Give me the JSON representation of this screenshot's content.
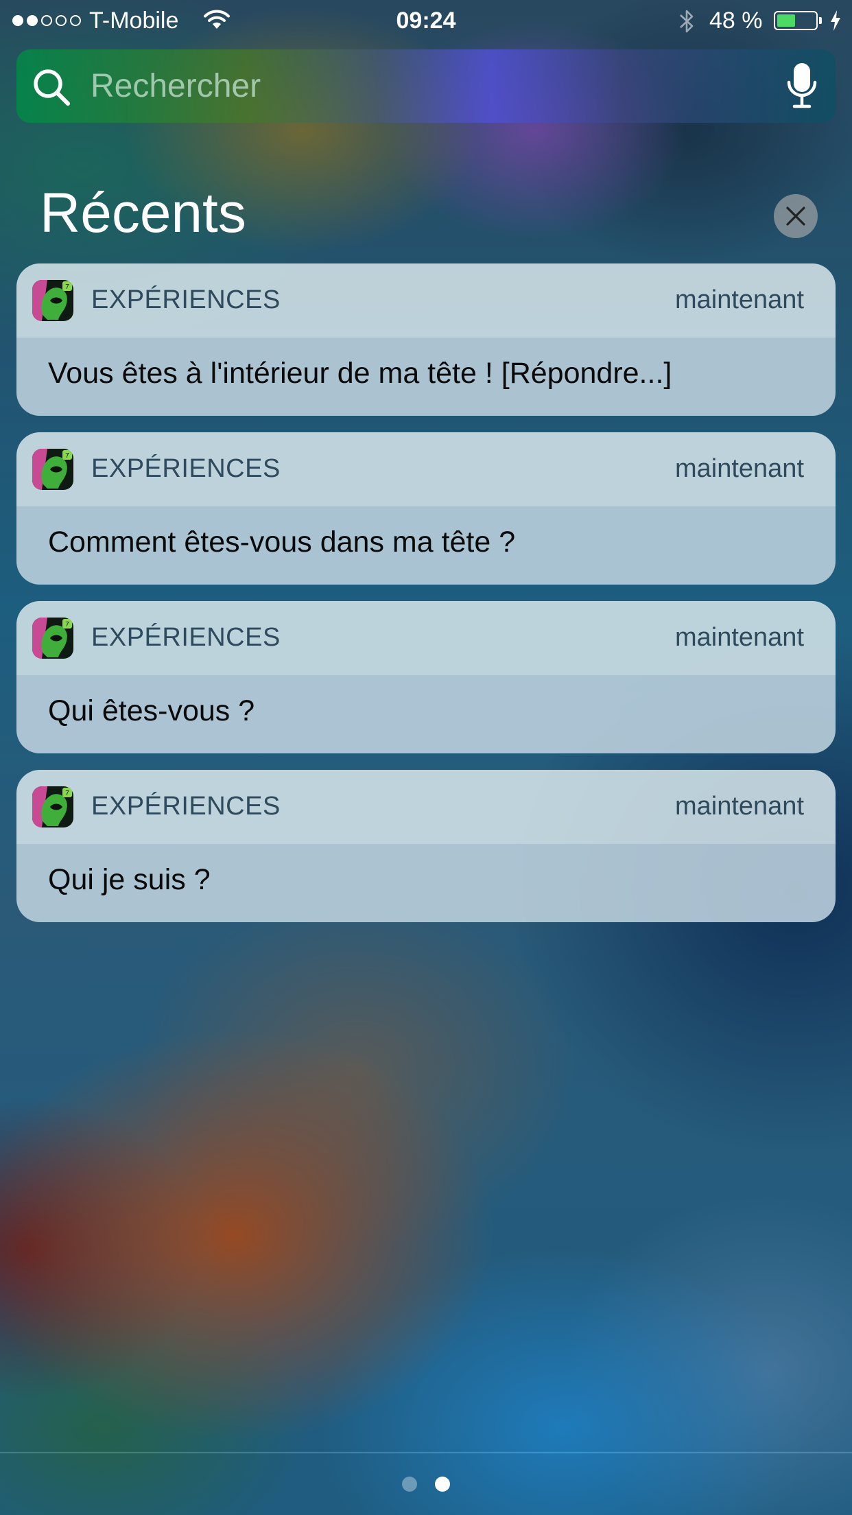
{
  "status_bar": {
    "signal_strength": 2,
    "signal_max": 5,
    "carrier": "T-Mobile",
    "time": "09:24",
    "battery_percent": "48 %",
    "battery_level": 0.48,
    "battery_color": "#4cd964",
    "icons": [
      "wifi-icon",
      "bluetooth-icon",
      "battery-icon",
      "charging-bolt-icon"
    ]
  },
  "search": {
    "placeholder": "Rechercher",
    "icon": "search-icon",
    "mic_icon": "microphone-icon"
  },
  "recents": {
    "title": "Récents",
    "clear_icon": "close-icon"
  },
  "notifications": [
    {
      "app": "EXPÉRIENCES",
      "time": "maintenant",
      "message": "Vous êtes à l'intérieur de ma tête ! [Répondre...]"
    },
    {
      "app": "EXPÉRIENCES",
      "time": "maintenant",
      "message": "Comment êtes-vous dans ma tête ?"
    },
    {
      "app": "EXPÉRIENCES",
      "time": "maintenant",
      "message": "Qui êtes-vous ?"
    },
    {
      "app": "EXPÉRIENCES",
      "time": "maintenant",
      "message": "Qui je suis ?"
    }
  ],
  "page_indicator": {
    "count": 2,
    "current": 2
  }
}
